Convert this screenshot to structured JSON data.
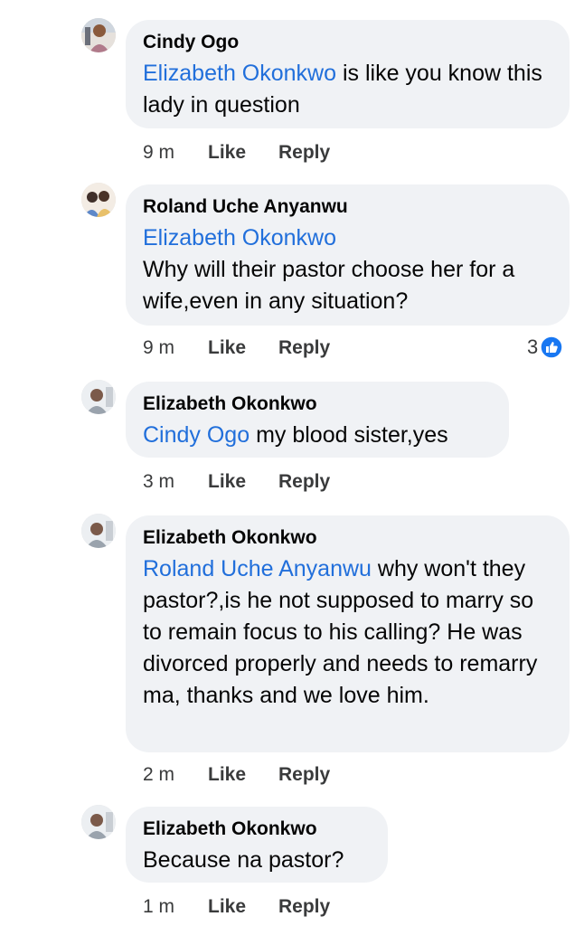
{
  "colors": {
    "bubble": "#f0f2f5",
    "mention": "#216fdb",
    "meta": "#3a3b3c",
    "like_badge": "#1877f2"
  },
  "comments": [
    {
      "author": "Cindy Ogo",
      "mention": "Elizabeth Okonkwo",
      "text": " is like you know this lady in question",
      "time": "9 m",
      "like_label": "Like",
      "reply_label": "Reply",
      "avatar_icon": "profile-photo"
    },
    {
      "author": "Roland Uche Anyanwu",
      "mention": "Elizabeth Okonkwo",
      "text": "Why will their pastor choose her for a wife,even in any situation?",
      "time": "9 m",
      "like_label": "Like",
      "reply_label": "Reply",
      "reaction_count": "3",
      "reaction_icon": "like-reaction",
      "avatar_icon": "profile-photo"
    },
    {
      "author": "Elizabeth Okonkwo",
      "mention": "Cindy Ogo",
      "text": " my blood sister,yes",
      "time": "3 m",
      "like_label": "Like",
      "reply_label": "Reply",
      "avatar_icon": "profile-photo"
    },
    {
      "author": "Elizabeth Okonkwo",
      "mention": "Roland Uche Anyanwu",
      "text": " why won't they pastor?,is he not supposed to marry so to remain focus to his calling? He was divorced properly and needs to remarry ma, thanks and we love him.",
      "time": "2 m",
      "like_label": "Like",
      "reply_label": "Reply",
      "avatar_icon": "profile-photo"
    },
    {
      "author": "Elizabeth Okonkwo",
      "mention": "",
      "text": "Because na pastor?",
      "time": "1 m",
      "like_label": "Like",
      "reply_label": "Reply",
      "avatar_icon": "profile-photo"
    }
  ]
}
